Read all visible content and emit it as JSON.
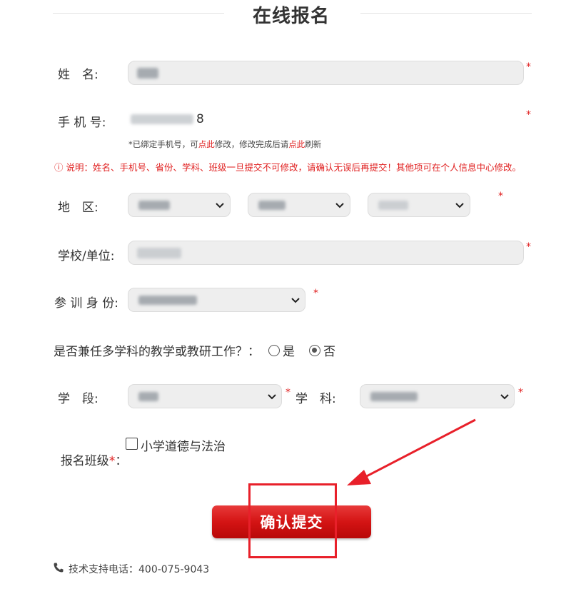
{
  "page": {
    "title": "在线报名"
  },
  "form": {
    "name": {
      "label": "姓　名:",
      "value_visible": "",
      "required_mark": "*"
    },
    "phone": {
      "label": "手 机 号:",
      "value_tail": "8",
      "required_mark": "*",
      "note_prefix": "*已绑定手机号，可",
      "note_link1": "点此",
      "note_mid": "修改，修改完成后请",
      "note_link2": "点此",
      "note_suffix": "刷新"
    },
    "warning": {
      "text": "ⓘ 说明：姓名、手机号、省份、学科、班级一旦提交不可修改，请确认无误后再提交！其他项可在个人信息中心修改。"
    },
    "region": {
      "label": "地　区:",
      "required_mark": "*"
    },
    "school": {
      "label": "学校/单位:",
      "required_mark": "*"
    },
    "role": {
      "label": "参 训 身 份:",
      "required_mark": "*"
    },
    "multi_subject": {
      "question": "是否兼任多学科的教学或教研工作？：",
      "option_yes": "是",
      "option_no": "否",
      "selected": "否"
    },
    "stage": {
      "label": "学　段:",
      "required_mark": "*"
    },
    "subject": {
      "label": "学　科:",
      "required_mark": "*"
    },
    "class_signup": {
      "label": "报名班级",
      "required_mark": "*",
      "label_colon": "：",
      "option": "小学道德与法治",
      "checked": false
    },
    "submit_label": "确认提交"
  },
  "support": {
    "phone_icon": "phone-icon",
    "text": "技术支持电话：400-075-9043"
  },
  "annotations": {
    "arrow_color": "#e8202a",
    "highlight_color": "#e8202a"
  },
  "colors": {
    "accent_red": "#e02020",
    "button_red": "#d41414"
  }
}
